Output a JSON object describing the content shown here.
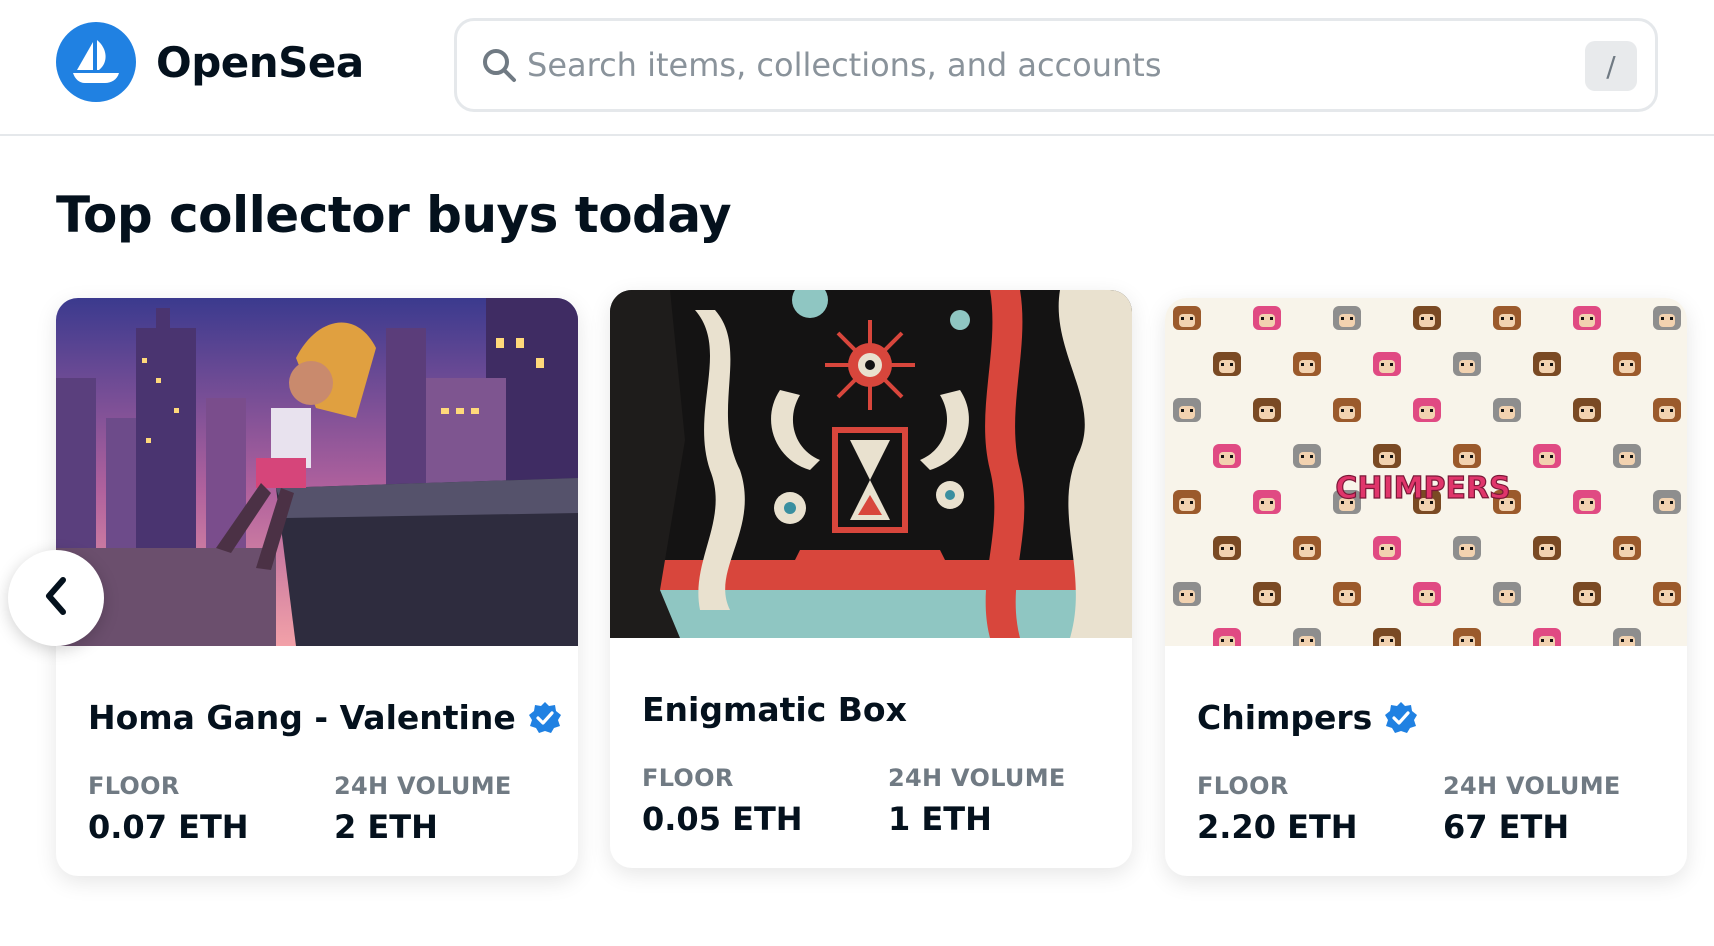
{
  "header": {
    "brand": "OpenSea",
    "search_placeholder": "Search items, collections, and accounts",
    "search_shortcut": "/"
  },
  "section": {
    "title": "Top collector buys today"
  },
  "cards": [
    {
      "name": "Homa Gang - Valentine",
      "verified": true,
      "floor_label": "FLOOR",
      "floor_value": "0.07 ETH",
      "volume_label": "24H VOLUME",
      "volume_value": "2 ETH"
    },
    {
      "name": "Enigmatic Box",
      "verified": false,
      "floor_label": "FLOOR",
      "floor_value": "0.05 ETH",
      "volume_label": "24H VOLUME",
      "volume_value": "1 ETH"
    },
    {
      "name": "Chimpers",
      "verified": true,
      "floor_label": "FLOOR",
      "floor_value": "2.20 ETH",
      "volume_label": "24H VOLUME",
      "volume_value": "67 ETH"
    }
  ],
  "artwork_text": {
    "chimpers_logo": "CHIMPERS"
  },
  "icons": {
    "logo": "opensea-boat-icon",
    "search": "search-icon",
    "verified": "verified-badge-icon",
    "prev": "chevron-left-icon"
  },
  "colors": {
    "brand_blue": "#2081e2",
    "text_primary": "#04111d",
    "text_secondary": "#707a83",
    "border": "#e5e8eb"
  }
}
